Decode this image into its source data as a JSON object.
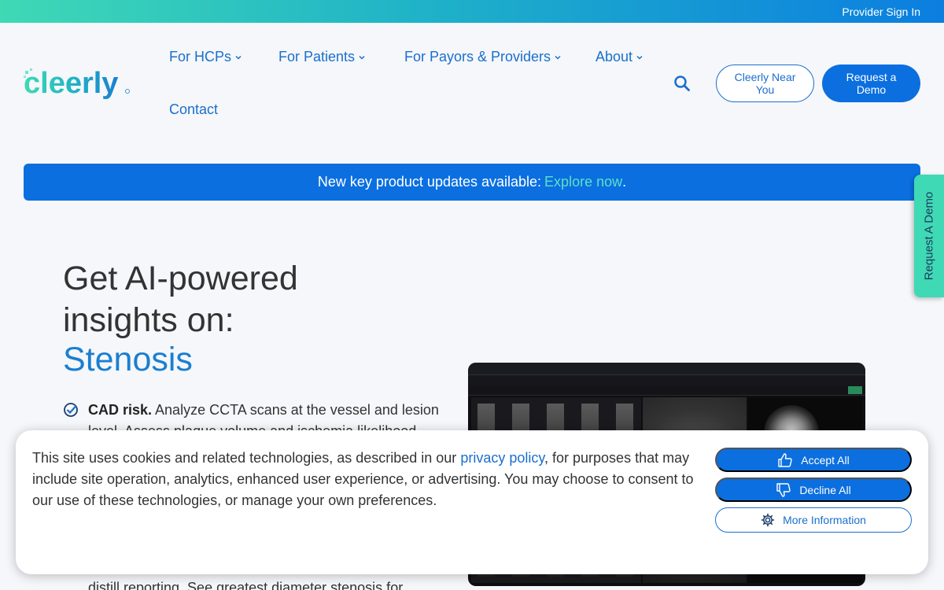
{
  "topbar": {
    "signin_label": "Provider Sign In"
  },
  "brand": {
    "logo_text": "cleerly"
  },
  "nav": {
    "items": [
      {
        "label": "For HCPs",
        "has_dropdown": true
      },
      {
        "label": "For Patients",
        "has_dropdown": true
      },
      {
        "label": "For Payors & Providers",
        "has_dropdown": true
      },
      {
        "label": "About",
        "has_dropdown": true
      },
      {
        "label": "Contact",
        "has_dropdown": false
      }
    ],
    "search_icon": "search-icon"
  },
  "header_buttons": {
    "near_you_label": "Cleerly Near You",
    "demo_label": "Request a Demo"
  },
  "banner": {
    "text": "New key product updates available:",
    "link_label": "Explore now",
    "suffix": "."
  },
  "side_tab": {
    "label": "Request A Demo"
  },
  "hero": {
    "title": "Get AI-powered insights on:",
    "accent": "Stenosis"
  },
  "features": [
    {
      "bold": "CAD risk.",
      "text": " Analyze CCTA scans at the vessel and lesion level. Assess plaque volume and ischemia likelihood"
    },
    {
      "text": "distill reporting. See greatest diameter stenosis for"
    }
  ],
  "cookie": {
    "text_before": "This site uses cookies and related technologies, as described in our ",
    "link_label": "privacy policy",
    "text_after": ", for purposes that may include site operation, analytics, enhanced user experience, or advertising. You may choose to consent to our use of these technologies, or manage your own preferences.",
    "accept_label": "Accept All",
    "decline_label": "Decline All",
    "more_label": "More Information"
  },
  "colors": {
    "primary": "#0b6fe0",
    "link": "#1a6fce",
    "accent_teal": "#3fd9b5"
  }
}
